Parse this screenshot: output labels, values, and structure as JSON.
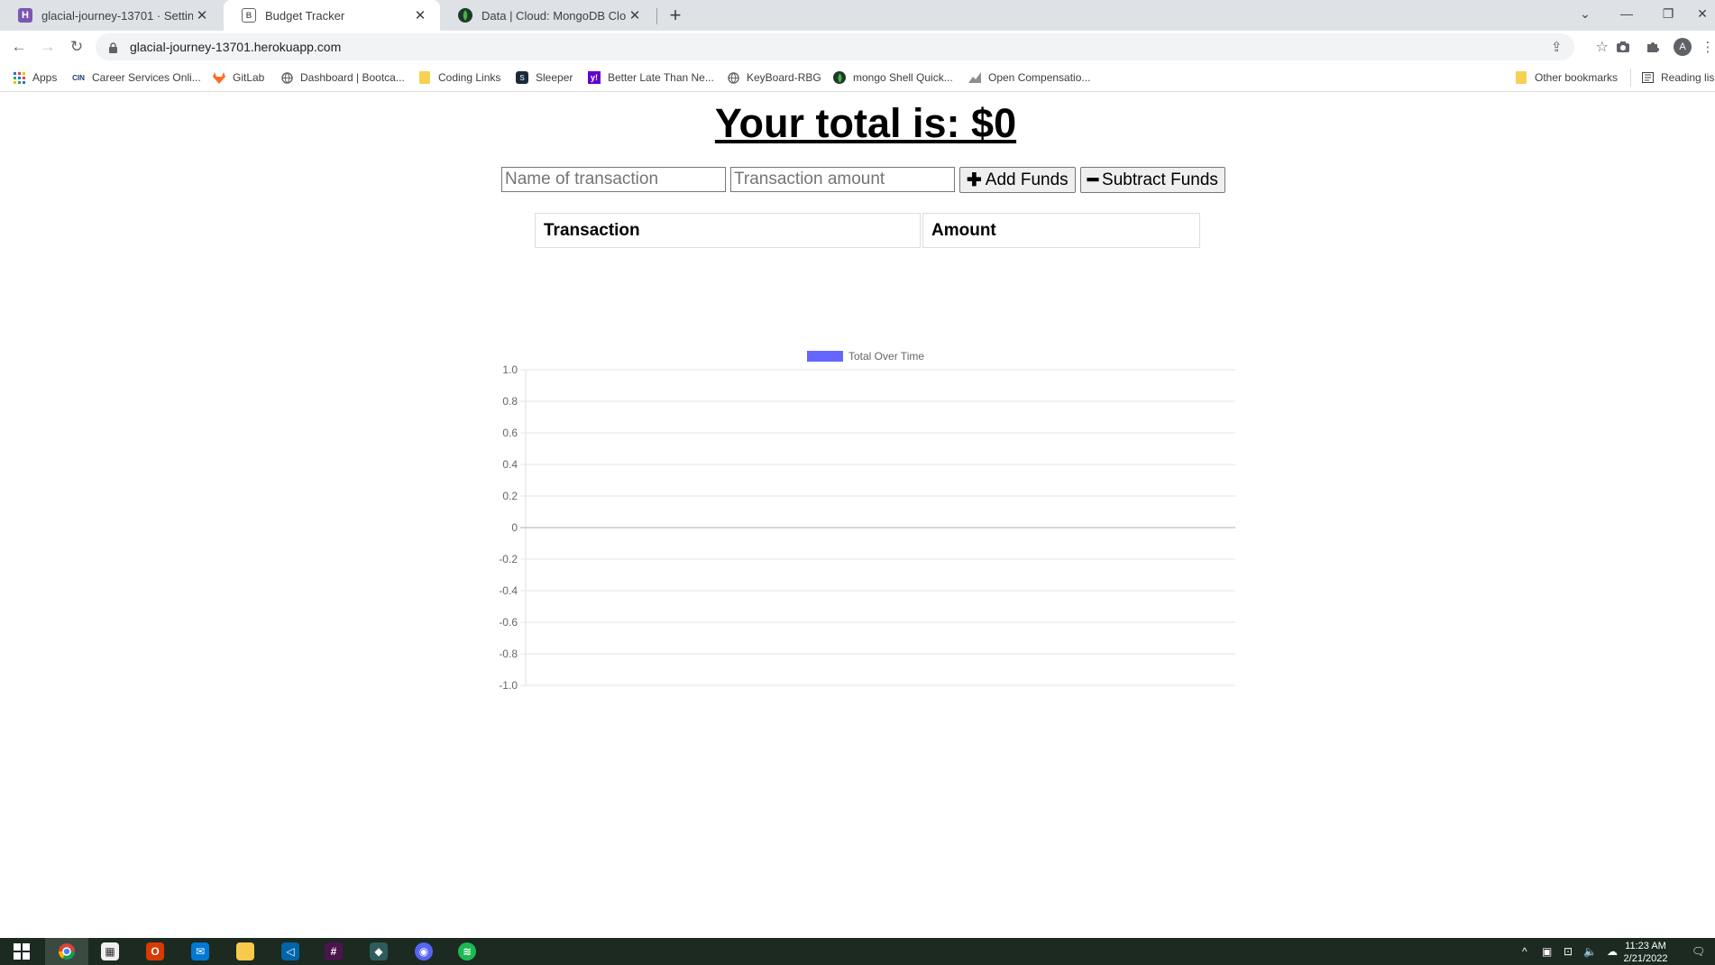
{
  "browser": {
    "tabs": [
      {
        "title": "glacial-journey-13701 · Settings |",
        "favicon": "heroku-icon",
        "active": false
      },
      {
        "title": "Budget Tracker",
        "favicon": "page-icon",
        "active": true
      },
      {
        "title": "Data | Cloud: MongoDB Cloud",
        "favicon": "mongodb-leaf-icon",
        "active": false
      }
    ],
    "url": "glacial-journey-13701.herokuapp.com",
    "avatar_letter": "A",
    "bookmarks": [
      {
        "label": "Apps",
        "icon": "apps-grid-icon"
      },
      {
        "label": "Career Services Onli...",
        "icon": "cin-icon"
      },
      {
        "label": "GitLab",
        "icon": "gitlab-icon"
      },
      {
        "label": "Dashboard | Bootca...",
        "icon": "globe-icon"
      },
      {
        "label": "Coding Links",
        "icon": "folder-icon"
      },
      {
        "label": "Sleeper",
        "icon": "sleeper-icon"
      },
      {
        "label": "Better Late Than Ne...",
        "icon": "yahoo-icon"
      },
      {
        "label": "KeyBoard-RBG",
        "icon": "globe-icon"
      },
      {
        "label": "mongo Shell Quick...",
        "icon": "mongodb-leaf-icon"
      },
      {
        "label": "Open Compensatio...",
        "icon": "chart-icon"
      }
    ],
    "other_bookmarks": "Other bookmarks",
    "reading_list": "Reading lis"
  },
  "app": {
    "total_heading": "Your total is: $0",
    "name_placeholder": "Name of transaction",
    "amount_placeholder": "Transaction amount",
    "add_label": "Add Funds",
    "subtract_label": "Subtract Funds",
    "table_headers": [
      "Transaction",
      "Amount"
    ]
  },
  "chart_data": {
    "type": "line",
    "series": [
      {
        "name": "Total Over Time",
        "values": [],
        "color": "#6666ff"
      }
    ],
    "x": [],
    "ylim": [
      -1.0,
      1.0
    ],
    "yticks": [
      "1.0",
      "0.8",
      "0.6",
      "0.4",
      "0.2",
      "0",
      "-0.2",
      "-0.4",
      "-0.6",
      "-0.8",
      "-1.0"
    ],
    "grid": true,
    "legend": "top-center"
  },
  "taskbar": {
    "time": "11:23 AM",
    "date": "2/21/2022"
  }
}
